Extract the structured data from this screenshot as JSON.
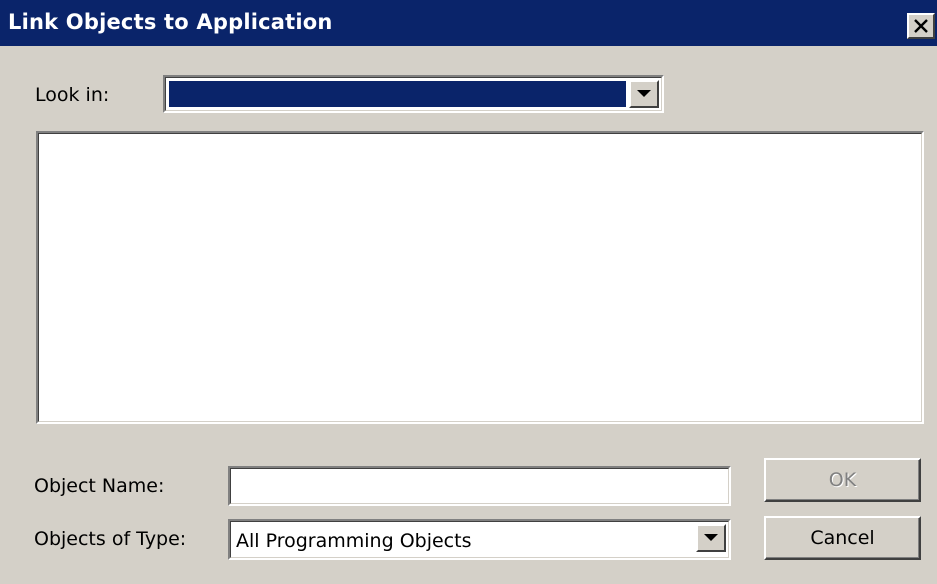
{
  "window": {
    "title": "Link Objects to Application"
  },
  "look_in": {
    "label": "Look in:",
    "selected": ""
  },
  "file_list": {
    "items": []
  },
  "object_name": {
    "label": "Object Name:",
    "value": ""
  },
  "objects_of_type": {
    "label": "Objects of Type:",
    "selected": "All Programming Objects"
  },
  "buttons": {
    "ok": "OK",
    "cancel": "Cancel"
  },
  "icons": {
    "close": "close-icon",
    "dropdown": "chevron-down-icon"
  },
  "colors": {
    "titlebar": "#0a246a",
    "face": "#d4d0c8",
    "selection": "#0a246a"
  },
  "state": {
    "ok_enabled": false
  }
}
